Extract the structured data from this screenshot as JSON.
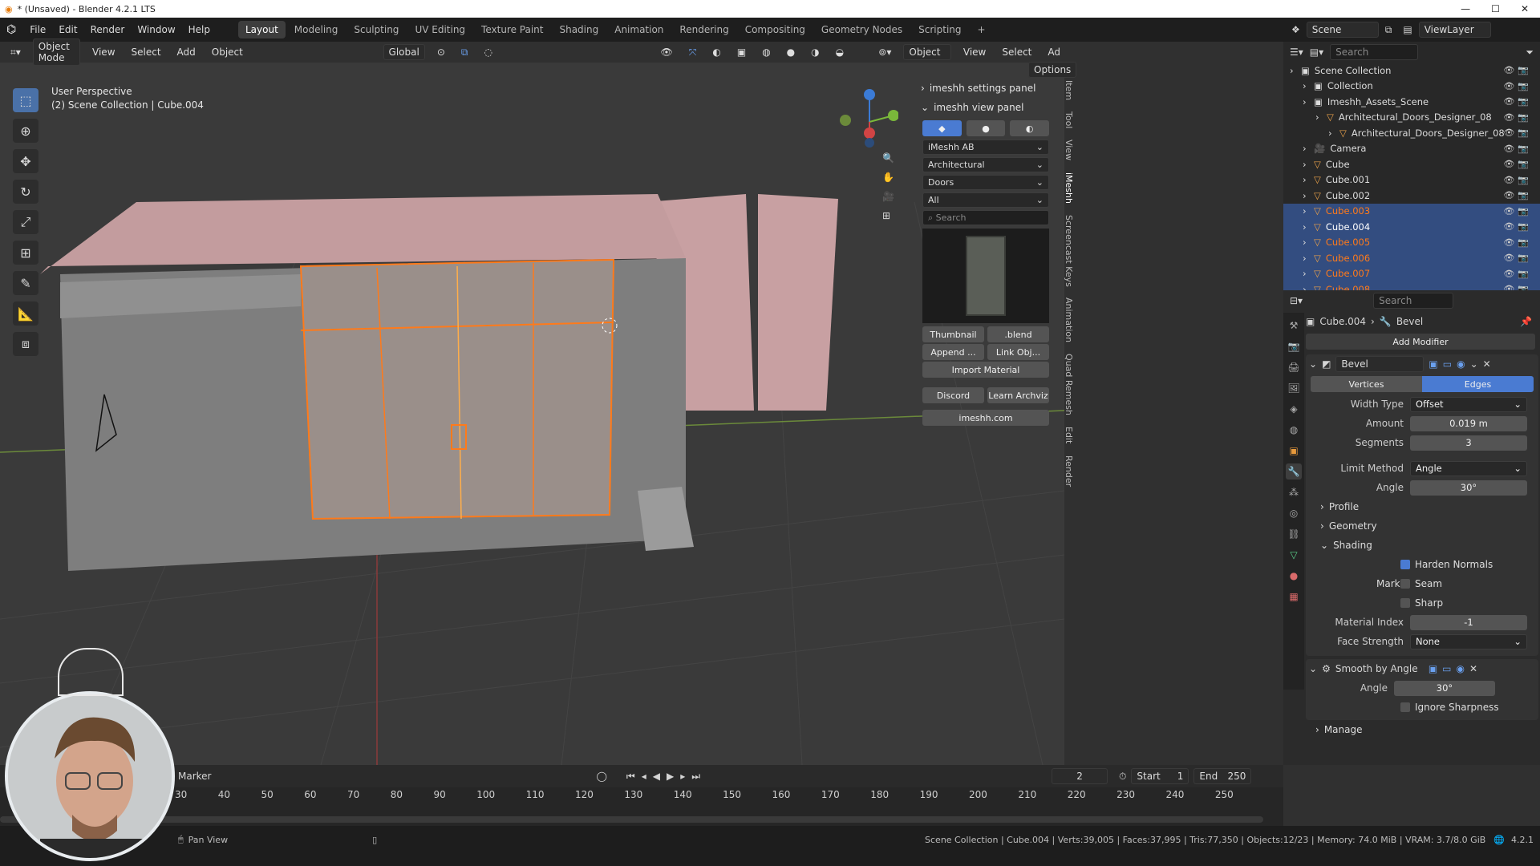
{
  "window": {
    "title": "* (Unsaved) - Blender 4.2.1 LTS"
  },
  "menu": [
    "File",
    "Edit",
    "Render",
    "Window",
    "Help"
  ],
  "workspaces": [
    "Layout",
    "Modeling",
    "Sculpting",
    "UV Editing",
    "Texture Paint",
    "Shading",
    "Animation",
    "Rendering",
    "Compositing",
    "Geometry Nodes",
    "Scripting"
  ],
  "scene": {
    "label": "Scene",
    "view_layer": "ViewLayer"
  },
  "viewport_header": {
    "mode": "Object Mode",
    "menus": [
      "View",
      "Select",
      "Add",
      "Object"
    ],
    "transform": "Global",
    "options": "Options",
    "right_mode": "Object",
    "right_menus": [
      "View",
      "Select",
      "Ad"
    ]
  },
  "viewport_info": {
    "line1": "User Perspective",
    "line2": "(2) Scene Collection | Cube.004"
  },
  "npanel": {
    "settings_panel": "imeshh settings panel",
    "view_panel": "imeshh view panel",
    "dd1": "iMeshh AB",
    "dd2": "Architectural",
    "dd3": "Doors",
    "dd4": "All",
    "search_placeholder": "Search",
    "thumbnail": "Thumbnail",
    "blend": ".blend",
    "append": "Append ...",
    "link": "Link Obj...",
    "import_material": "Import Material",
    "discord": "Discord",
    "learn": "Learn Archviz",
    "site": "imeshh.com"
  },
  "side_tabs": [
    "Item",
    "Tool",
    "View",
    "iMeshh",
    "Screencast Keys",
    "Animation",
    "Quad Remesh",
    "Edit",
    "Render"
  ],
  "outliner": {
    "search_placeholder": "Search",
    "rows": [
      {
        "name": "Scene Collection",
        "indent": 0,
        "selected": false,
        "orange": false
      },
      {
        "name": "Collection",
        "indent": 1,
        "selected": false,
        "orange": false
      },
      {
        "name": "Imeshh_Assets_Scene",
        "indent": 1,
        "selected": false,
        "orange": false
      },
      {
        "name": "Architectural_Doors_Designer_08",
        "indent": 2,
        "selected": false,
        "orange": false
      },
      {
        "name": "Architectural_Doors_Designer_08",
        "indent": 3,
        "selected": false,
        "orange": false
      },
      {
        "name": "Camera",
        "indent": 1,
        "selected": false,
        "orange": false
      },
      {
        "name": "Cube",
        "indent": 1,
        "selected": false,
        "orange": false
      },
      {
        "name": "Cube.001",
        "indent": 1,
        "selected": false,
        "orange": false
      },
      {
        "name": "Cube.002",
        "indent": 1,
        "selected": false,
        "orange": false
      },
      {
        "name": "Cube.003",
        "indent": 1,
        "selected": true,
        "orange": true
      },
      {
        "name": "Cube.004",
        "indent": 1,
        "selected": true,
        "orange": false
      },
      {
        "name": "Cube.005",
        "indent": 1,
        "selected": true,
        "orange": true
      },
      {
        "name": "Cube.006",
        "indent": 1,
        "selected": true,
        "orange": true
      },
      {
        "name": "Cube.007",
        "indent": 1,
        "selected": true,
        "orange": true
      },
      {
        "name": "Cube.008",
        "indent": 1,
        "selected": true,
        "orange": true
      }
    ]
  },
  "properties": {
    "search_placeholder": "Search",
    "object": "Cube.004",
    "modifier_crumb": "Bevel",
    "add_modifier": "Add Modifier",
    "bevel": {
      "name": "Bevel",
      "vertices": "Vertices",
      "edges": "Edges",
      "width_type_label": "Width Type",
      "width_type": "Offset",
      "amount_label": "Amount",
      "amount": "0.019 m",
      "segments_label": "Segments",
      "segments": "3",
      "limit_label": "Limit Method",
      "limit": "Angle",
      "angle_label": "Angle",
      "angle": "30°",
      "profile": "Profile",
      "geometry": "Geometry",
      "shading": "Shading",
      "harden": "Harden Normals",
      "mark_label": "Mark",
      "seam": "Seam",
      "sharp": "Sharp",
      "matidx_label": "Material Index",
      "matidx": "-1",
      "face_label": "Face Strength",
      "face": "None"
    },
    "smooth": {
      "name": "Smooth by Angle",
      "angle_label": "Angle",
      "angle": "30°",
      "ignore": "Ignore Sharpness",
      "manage": "Manage"
    }
  },
  "timeline": {
    "marker": "Marker",
    "current": "2",
    "start_label": "Start",
    "start": "1",
    "end_label": "End",
    "end": "250",
    "ticks": [
      "30",
      "40",
      "50",
      "60",
      "70",
      "80",
      "90",
      "100",
      "110",
      "120",
      "130",
      "140",
      "150",
      "160",
      "170",
      "180",
      "190",
      "200",
      "210",
      "220",
      "230",
      "240",
      "250"
    ]
  },
  "status": {
    "pan": "Pan View",
    "info": "Scene Collection | Cube.004 | Verts:39,005 | Faces:37,995 | Tris:77,350 | Objects:12/23 | Memory: 74.0 MiB | VRAM: 3.7/8.0 GiB",
    "version": "4.2.1"
  },
  "colors": {
    "accent": "#4a7bd2",
    "selected_orange": "#ff7a1a",
    "selected_row": "#334d80"
  }
}
